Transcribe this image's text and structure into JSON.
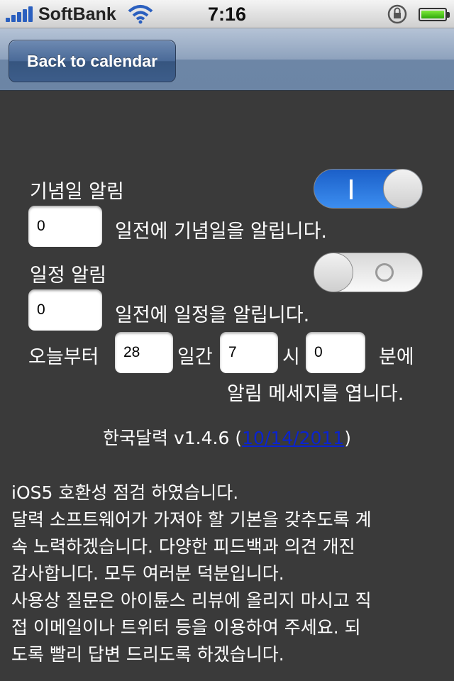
{
  "status_bar": {
    "carrier": "SoftBank",
    "time": "7:16",
    "signal_bars": 5,
    "battery_level": 1.0,
    "icons": [
      "signal-icon",
      "wifi-icon",
      "rotation-lock-icon",
      "battery-icon"
    ]
  },
  "nav": {
    "back_label": "Back to calendar"
  },
  "anniversary": {
    "label": "기념일 알림",
    "switch_on": true,
    "days_value": "0",
    "days_suffix": "일전에 기념일을 알립니다."
  },
  "schedule": {
    "label": "일정 알림",
    "switch_on": false,
    "days_value": "0",
    "days_suffix": "일전에 일정을 알립니다."
  },
  "window": {
    "prefix": "오늘부터",
    "days_value": "28",
    "days_unit": "일간",
    "hour_value": "7",
    "hour_unit": "시",
    "minute_value": "0",
    "minute_unit": "분에",
    "suffix": "알림 메세지를 엽니다."
  },
  "version": {
    "text": "한국달력 v1.4.6 (",
    "date_link": "10/14/2011",
    "close": ")"
  },
  "notes": [
    "iOS5 호환성 점검 하였습니다.",
    "달력 소프트웨어가 가져야 할 기본을 갖추도록 계",
    "속 노력하겠습니다. 다양한 피드백과 의견 개진",
    "감사합니다. 모두 여러분 덕분입니다.",
    "사용상 질문은 아이튠스 리뷰에 올리지 마시고 직",
    "접 이메일이나 트위터 등을 이용하여 주세요. 되",
    "도록 빨리 답변 드리도록 하겠습니다."
  ],
  "colors": {
    "background": "#3a3a3a",
    "switch_on": "#2a74dc",
    "link": "#0a23d0"
  }
}
